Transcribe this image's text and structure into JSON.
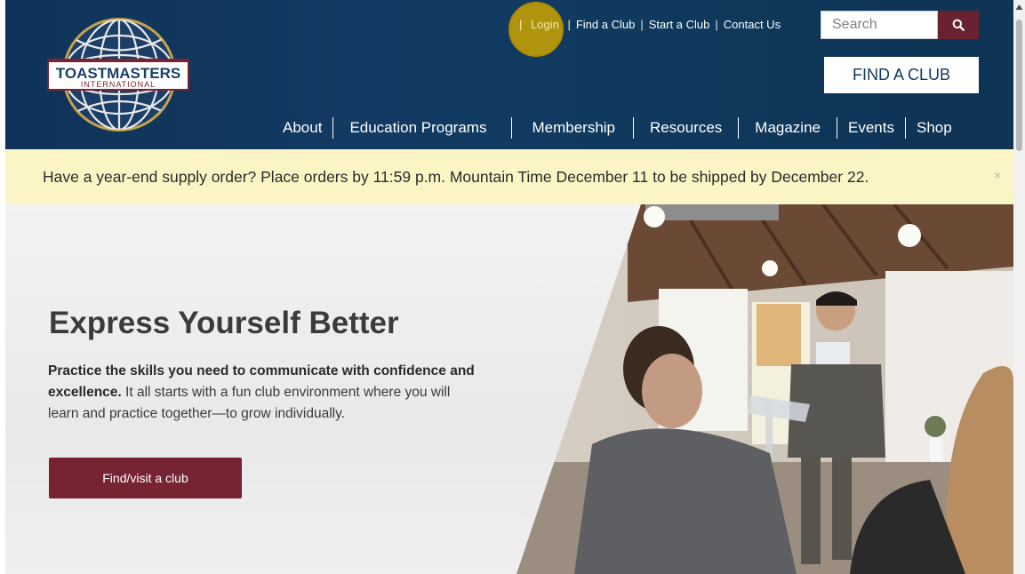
{
  "brand": {
    "logo_line1": "TOASTMASTERS",
    "logo_line2": "INTERNATIONAL"
  },
  "utility_nav": {
    "login": "Login",
    "find_club": "Find a Club",
    "start_club": "Start a Club",
    "contact": "Contact Us",
    "separator": "|"
  },
  "search": {
    "placeholder": "Search",
    "icon": "search-icon"
  },
  "cta_header": {
    "label": "FIND A CLUB"
  },
  "main_nav": {
    "items": [
      "About",
      "Education Programs",
      "Membership",
      "Resources",
      "Magazine",
      "Events",
      "Shop"
    ]
  },
  "announcement": {
    "text": "Have a year-end supply order? Place orders by 11:59 p.m. Mountain Time December 11 to be shipped by December 22.",
    "close": "×"
  },
  "hero": {
    "title": "Express Yourself Better",
    "body_bold": "Practice the skills you need to communicate with confidence and excellence.",
    "body_rest": " It all starts with a fun club environment where you will learn and practice together—to grow individually.",
    "button": "Find/visit a club"
  },
  "colors": {
    "header_navy": "#0f3358",
    "accent_maroon": "#772432",
    "banner_yellow": "#fbf4c5",
    "highlight_gold": "#cda500"
  }
}
